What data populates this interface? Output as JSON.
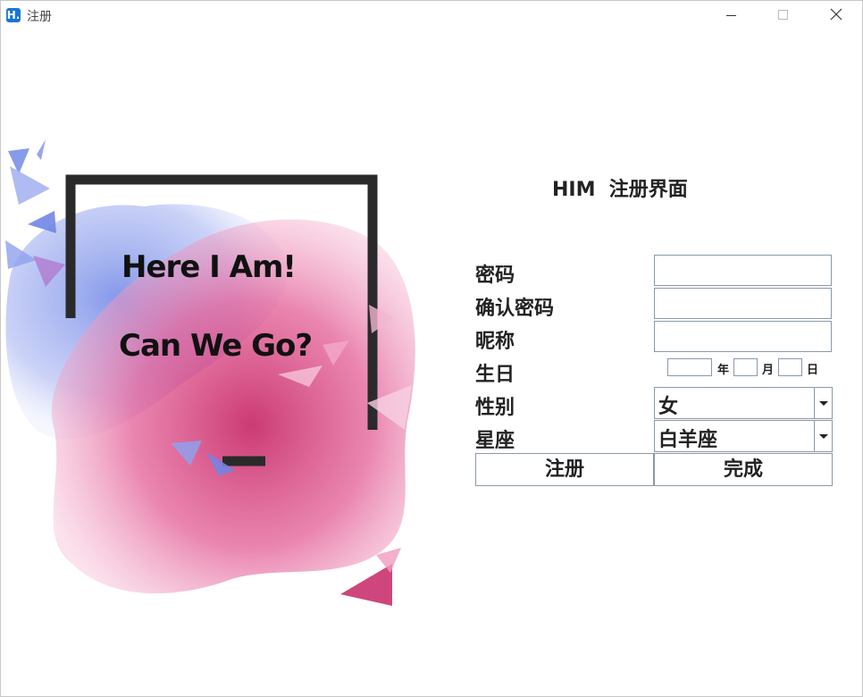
{
  "window": {
    "title": "注册",
    "app_icon_letter": "H."
  },
  "artwork": {
    "line1": "Here  I Am!",
    "line2": "Can We Go?"
  },
  "form": {
    "title": "HIM  注册界面",
    "labels": {
      "password": "密码",
      "confirm_password": "确认密码",
      "nickname": "昵称",
      "birthday": "生日",
      "gender": "性别",
      "zodiac": "星座"
    },
    "values": {
      "password": "",
      "confirm_password": "",
      "nickname": "",
      "year": "",
      "month": "",
      "day": ""
    },
    "date_units": {
      "year": "年",
      "month": "月",
      "day": "日"
    },
    "gender_selected": "女",
    "zodiac_selected": "白羊座",
    "register_button": "注册",
    "done_button": "完成"
  },
  "colors": {
    "accent": "#1976d2",
    "field_border": "#8a9aa8",
    "art_pink": "#d94c8a",
    "art_blue": "#7a90e8"
  }
}
